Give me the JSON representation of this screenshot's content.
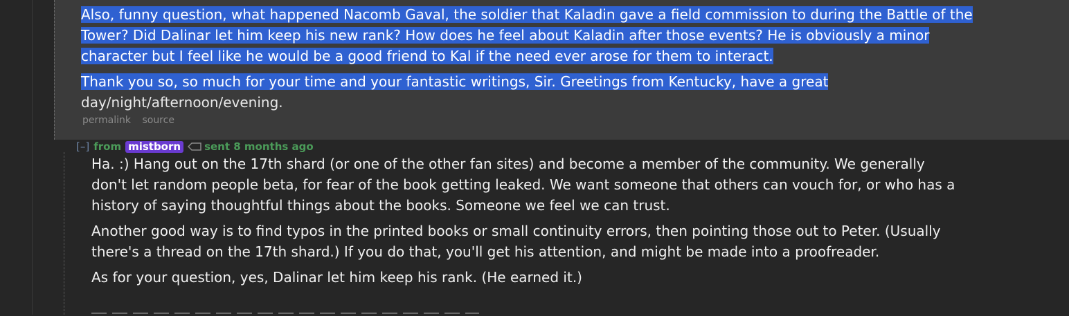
{
  "quoted_message": {
    "paragraphs": [
      "Also, funny question, what happened Nacomb Gaval, the soldier that Kaladin gave a field commission to during the Battle of the Tower? Did Dalinar let him keep his new rank? How does he feel about Kaladin after those events? He is obviously a minor character but I feel like he would be a good friend to Kal if the need ever arose for them to interact."
    ],
    "last_paragraph_selected": "Thank you so, so much for your time and your fantastic writings, Sir. Greetings from Kentucky, have a great",
    "last_paragraph_rest": " day/night/afternoon/evening.",
    "links": {
      "permalink": "permalink",
      "source": "source"
    }
  },
  "reply": {
    "collapse_label": "[–]",
    "from_label": "from",
    "subreddit": "mistborn",
    "sent_label": "sent 8 months ago",
    "paragraphs": [
      "Ha. :) Hang out on the 17th shard (or one of the other fan sites) and become a member of the community. We generally don't let random people beta, for fear of the book getting leaked. We want someone that others can vouch for, or who has a history of saying thoughtful things about the books. Someone we feel we can trust.",
      "Another good way is to find typos in the printed books or small continuity errors, then pointing those out to Peter. (Usually there's a thread on the 17th shard.) If you do that, you'll get his attention, and might be made into a proofreader.",
      "As for your question, yes, Dalinar let him keep his rank. (He earned it.)"
    ]
  },
  "colors": {
    "selection": "#2f61d1",
    "badge": "#6a3bd1",
    "meta_green": "#4b9b59"
  }
}
